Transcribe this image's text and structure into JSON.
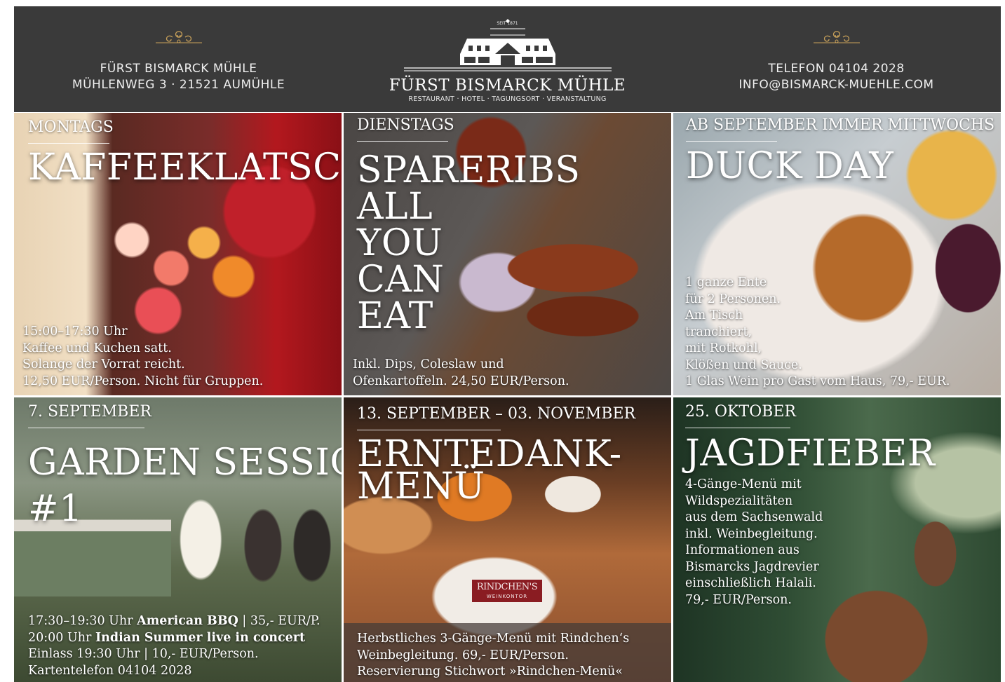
{
  "header": {
    "left": {
      "line1": "FÜRST BISMARCK MÜHLE",
      "line2": "MÜHLENWEG 3 · 21521 AUMÜHLE"
    },
    "center": {
      "since": "SEIT 1871",
      "name": "FÜRST BISMARCK MÜHLE",
      "tagline": "RESTAURANT · HOTEL · TAGUNGSORT · VERANSTALTUNG"
    },
    "right": {
      "line1": "TELEFON 04104 2028",
      "line2": "INFO@BISMARCK-MUEHLE.COM"
    }
  },
  "tiles": {
    "kaffee": {
      "tag": "MONTAGS",
      "title": "KAFFEEKLATSCH",
      "lines": [
        "15:00–17:30 Uhr",
        "Kaffee und Kuchen satt.",
        "Solange der Vorrat reicht.",
        "12,50 EUR/Person. Nicht für Gruppen."
      ]
    },
    "ribs": {
      "tag": "DIENSTAGS",
      "title_lines": [
        "SPARERIBS",
        "ALL",
        "YOU",
        "CAN",
        "EAT"
      ],
      "lines": [
        "Inkl. Dips, Coleslaw und",
        "Ofenkartoffeln. 24,50 EUR/Person."
      ]
    },
    "duck": {
      "tag": "AB SEPTEMBER IMMER MITTWOCHS",
      "title": "DUCK DAY",
      "lines": [
        "1 ganze Ente",
        "für 2 Personen.",
        "Am Tisch",
        "tranchiert,",
        "mit Rotkohl,",
        "Klößen und Sauce.",
        "1 Glas Wein pro Gast vom Haus, 79,- EUR."
      ]
    },
    "garden": {
      "tag": "7. SEPTEMBER",
      "title_lines": [
        "GARDEN SESSION",
        "#1"
      ],
      "l1_time": "17:30–19:30 Uhr ",
      "l1_bold": "American BBQ",
      "l1_rest": "  |  35,- EUR/P.",
      "l2_time": "20:00 Uhr ",
      "l2_bold": "Indian Summer live in concert",
      "l3": "Einlass 19:30 Uhr  |  10,- EUR/Person.",
      "l4": "Kartentelefon 04104 2028"
    },
    "ernte": {
      "tag": "13. SEPTEMBER – 03. NOVEMBER",
      "title_lines": [
        "ERNTEDANK-",
        "MENÜ"
      ],
      "logo_top": "RINDCHEN'S",
      "logo_bottom": "WEINKONTOR",
      "lines": [
        "Herbstliches 3-Gänge-Menü mit Rindchen‘s",
        "Weinbegleitung. 69,- EUR/Person.",
        "Reservierung Stichwort »Rindchen-Menü«"
      ]
    },
    "jagd": {
      "tag": "25. OKTOBER",
      "title": "JAGDFIEBER",
      "lines": [
        "4-Gänge-Menü mit",
        "Wildspezialitäten",
        "aus dem Sachsenwald",
        "inkl. Weinbegleitung.",
        "Informationen aus",
        "Bismarcks Jagdrevier",
        "einschließlich Halali.",
        "79,- EUR/Person."
      ]
    }
  }
}
